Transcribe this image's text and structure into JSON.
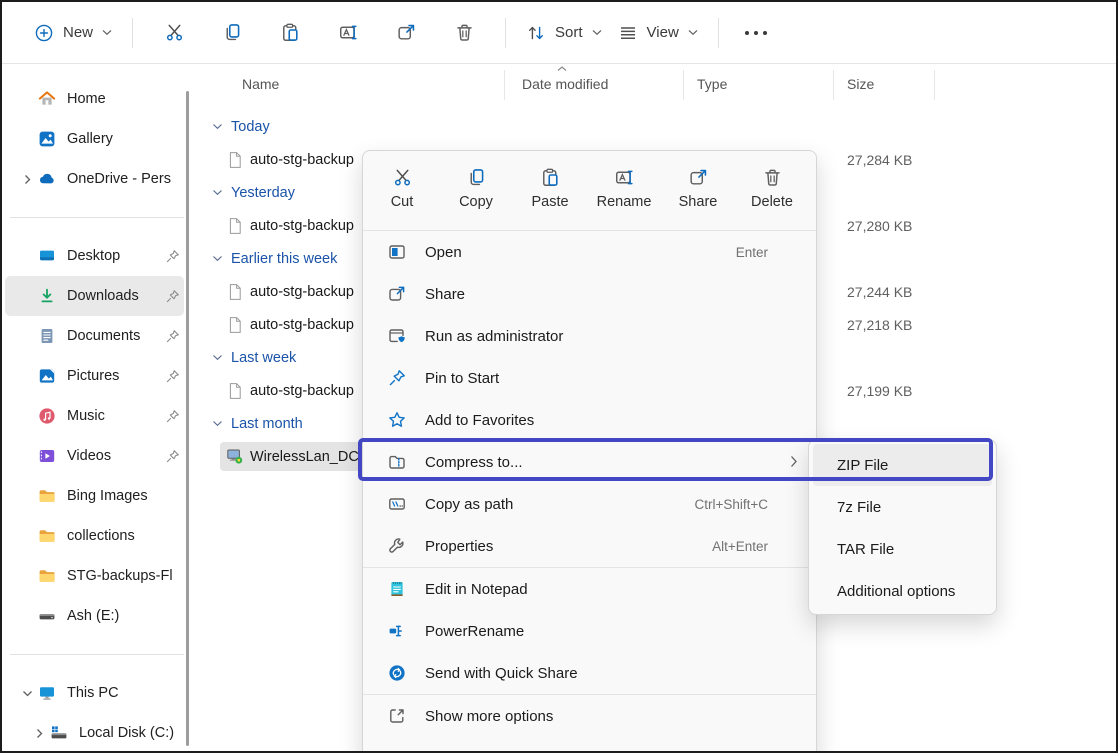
{
  "colors": {
    "accent_blue": "#0f6cbd",
    "annotation_box": "#4447c4",
    "group_header_blue": "#1a53a8",
    "selection_gray": "#e9e9e9",
    "downloads_green": "#15a363",
    "folder_yellow": "#fdce64",
    "menu_bg": "#f9f9f9"
  },
  "toolbar": {
    "new_label": "New",
    "sort_label": "Sort",
    "view_label": "View",
    "icon_buttons": [
      "cut-icon",
      "copy-icon",
      "paste-icon",
      "rename-icon",
      "share-icon",
      "delete-icon"
    ],
    "more_button": "ellipsis-icon"
  },
  "sidebar": {
    "items": [
      {
        "label": "Home",
        "icon": "home-icon"
      },
      {
        "label": "Gallery",
        "icon": "gallery-icon"
      },
      {
        "label": "OneDrive - Pers",
        "icon": "onedrive-icon",
        "expander": "right"
      },
      {
        "label": "Desktop",
        "icon": "desktop-icon",
        "pinned": true
      },
      {
        "label": "Downloads",
        "icon": "downloads-icon",
        "pinned": true,
        "selected": true
      },
      {
        "label": "Documents",
        "icon": "documents-icon",
        "pinned": true
      },
      {
        "label": "Pictures",
        "icon": "pictures-icon",
        "pinned": true
      },
      {
        "label": "Music",
        "icon": "music-icon",
        "pinned": true
      },
      {
        "label": "Videos",
        "icon": "videos-icon",
        "pinned": true
      },
      {
        "label": "Bing Images",
        "icon": "folder-icon"
      },
      {
        "label": "collections",
        "icon": "folder-icon"
      },
      {
        "label": "STG-backups-Fl",
        "icon": "folder-icon"
      },
      {
        "label": "Ash (E:)",
        "icon": "drive-icon"
      },
      {
        "label": "This PC",
        "icon": "this-pc-icon",
        "expander": "down"
      },
      {
        "label": "Local Disk (C:)",
        "icon": "local-disk-icon",
        "expander": "right"
      }
    ]
  },
  "file_pane": {
    "columns": [
      "Name",
      "Date modified",
      "Type",
      "Size"
    ],
    "sorted_by": "Date modified",
    "groups": [
      {
        "label": "Today",
        "files": [
          {
            "name": "auto-stg-backup",
            "size": "27,284 KB"
          }
        ]
      },
      {
        "label": "Yesterday",
        "files": [
          {
            "name": "auto-stg-backup",
            "size": "27,280 KB"
          }
        ]
      },
      {
        "label": "Earlier this week",
        "files": [
          {
            "name": "auto-stg-backup",
            "size": "27,244 KB"
          },
          {
            "name": "auto-stg-backup",
            "size": "27,218 KB"
          }
        ]
      },
      {
        "label": "Last week",
        "files": [
          {
            "name": "auto-stg-backup",
            "size": "27,199 KB"
          }
        ]
      },
      {
        "label": "Last month",
        "files": [
          {
            "name": "WirelessLan_DC",
            "selected": true
          }
        ]
      }
    ]
  },
  "context_menu": {
    "quick_actions": [
      {
        "label": "Cut",
        "icon": "cut-icon"
      },
      {
        "label": "Copy",
        "icon": "copy-icon"
      },
      {
        "label": "Paste",
        "icon": "paste-icon"
      },
      {
        "label": "Rename",
        "icon": "rename-icon"
      },
      {
        "label": "Share",
        "icon": "share-icon"
      },
      {
        "label": "Delete",
        "icon": "delete-icon"
      }
    ],
    "items": [
      {
        "label": "Open",
        "shortcut": "Enter",
        "icon": "open-icon"
      },
      {
        "label": "Share",
        "icon": "share-icon"
      },
      {
        "label": "Run as administrator",
        "icon": "admin-shield-icon"
      },
      {
        "label": "Pin to Start",
        "icon": "pin-outline-icon"
      },
      {
        "label": "Add to Favorites",
        "icon": "star-icon"
      },
      {
        "label": "Compress to...",
        "icon": "compress-zip-icon",
        "has_submenu": true
      },
      {
        "label": "Copy as path",
        "shortcut": "Ctrl+Shift+C",
        "icon": "copy-path-icon"
      },
      {
        "label": "Properties",
        "shortcut": "Alt+Enter",
        "icon": "wrench-icon"
      },
      {
        "label": "Edit in Notepad",
        "icon": "notepad-icon"
      },
      {
        "label": "PowerRename",
        "icon": "powerrename-icon"
      },
      {
        "label": "Send with Quick Share",
        "icon": "quick-share-icon"
      },
      {
        "label": "Show more options",
        "icon": "show-more-icon"
      }
    ]
  },
  "compress_submenu": {
    "items": [
      {
        "label": "ZIP File",
        "highlighted": true
      },
      {
        "label": "7z File"
      },
      {
        "label": "TAR File"
      },
      {
        "label": "Additional options"
      }
    ]
  }
}
